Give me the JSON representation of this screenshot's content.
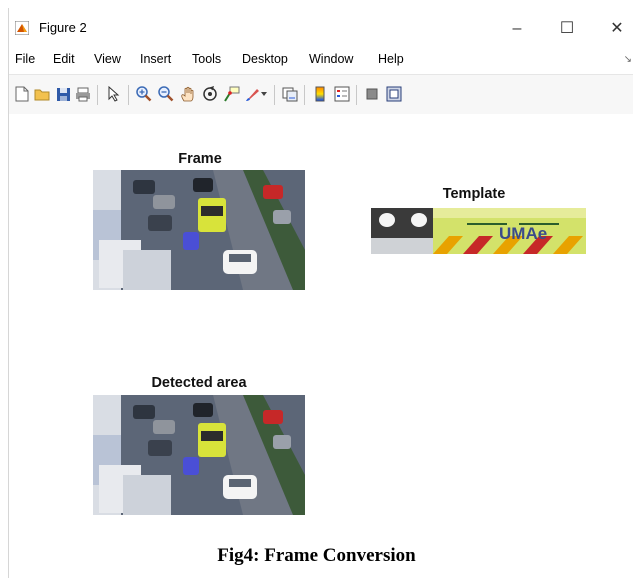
{
  "window": {
    "title": "Figure 2"
  },
  "window_controls": {
    "minimize": "–",
    "maximize": "☐",
    "close": "✕"
  },
  "menu": {
    "items": [
      "File",
      "Edit",
      "View",
      "Insert",
      "Tools",
      "Desktop",
      "Window",
      "Help"
    ],
    "overflow_arrow": "↘"
  },
  "toolbar": {
    "icons": [
      "new-figure-icon",
      "open-file-icon",
      "save-icon",
      "print-icon",
      "pointer-icon",
      "zoom-in-icon",
      "zoom-out-icon",
      "pan-icon",
      "rotate-3d-icon",
      "data-cursor-icon",
      "brush-icon",
      "link-plot-icon",
      "colorbar-icon",
      "legend-icon",
      "hide-plot-tools-icon",
      "show-plot-tools-icon"
    ]
  },
  "figure": {
    "frame_title": "Frame",
    "template_title": "Template",
    "detected_title": "Detected area",
    "template_text": "UMAe"
  },
  "caption": "Fig4: Frame Conversion"
}
